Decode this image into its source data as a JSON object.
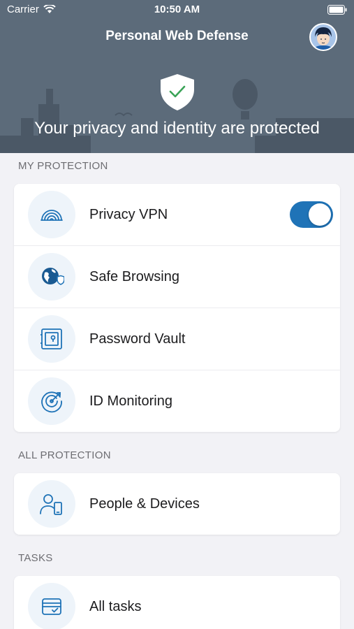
{
  "status_bar": {
    "carrier": "Carrier",
    "time": "10:50 AM",
    "wifi_icon": "wifi-icon",
    "battery_icon": "battery-icon"
  },
  "header": {
    "title": "Personal Web Defense",
    "avatar_icon": "user-avatar",
    "shield_icon": "shield-check-icon",
    "message": "Your privacy and identity are protected"
  },
  "sections": {
    "my_protection": {
      "title": "MY PROTECTION",
      "items": [
        {
          "label": "Privacy VPN",
          "icon": "vpn-signal-icon",
          "toggle_on": true
        },
        {
          "label": "Safe Browsing",
          "icon": "globe-shield-icon"
        },
        {
          "label": "Password Vault",
          "icon": "vault-icon"
        },
        {
          "label": "ID Monitoring",
          "icon": "radar-icon"
        }
      ]
    },
    "all_protection": {
      "title": "ALL PROTECTION",
      "items": [
        {
          "label": "People & Devices",
          "icon": "person-device-icon"
        }
      ]
    },
    "tasks": {
      "title": "TASKS",
      "items": [
        {
          "label": "All tasks",
          "icon": "tasks-card-icon"
        }
      ]
    }
  },
  "colors": {
    "header_bg": "#5c6b7a",
    "accent": "#1f73b7",
    "page_bg": "#f2f2f6"
  }
}
